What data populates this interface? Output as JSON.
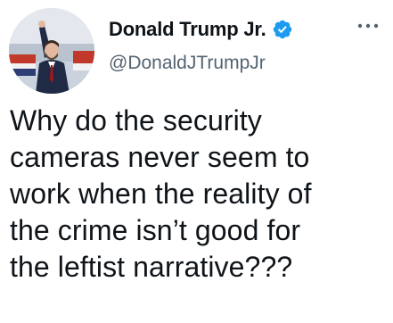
{
  "author": {
    "display_name": "Donald Trump Jr.",
    "handle": "@DonaldJTrumpJr",
    "verified": true,
    "verified_color": "#1d9bf0"
  },
  "tweet": {
    "text": "Why do the security\ncameras never seem to\nwork when the reality of\nthe crime isn’t good for\nthe leftist narrative???"
  },
  "icons": {
    "more": "more-horizontal-icon",
    "verified": "verified-badge-icon"
  }
}
